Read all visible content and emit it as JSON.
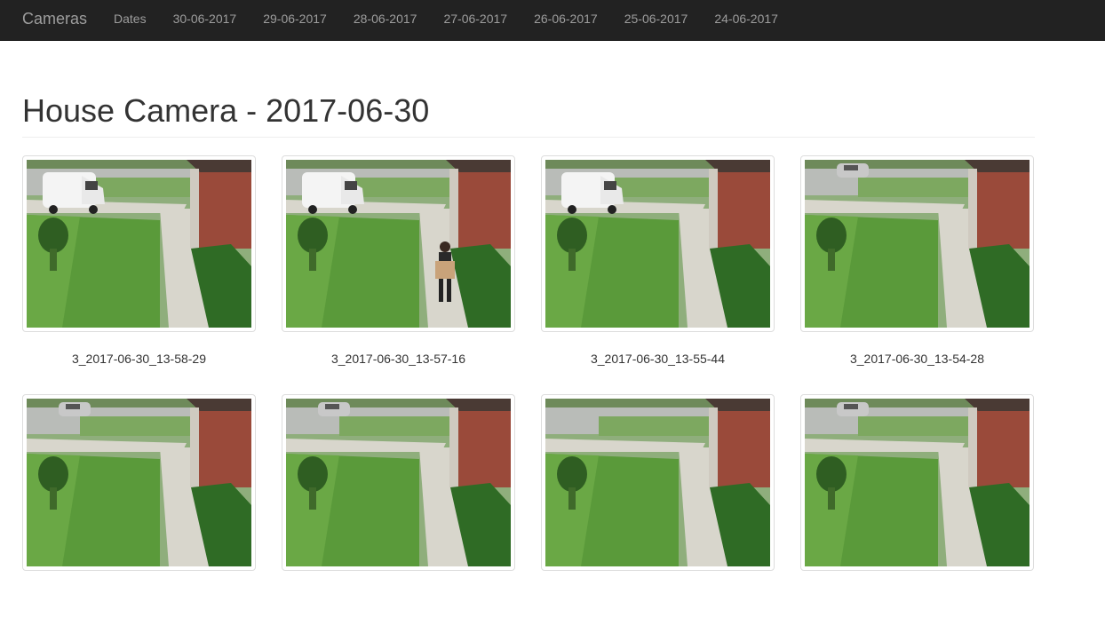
{
  "navbar": {
    "brand": "Cameras",
    "items": [
      "Dates",
      "30-06-2017",
      "29-06-2017",
      "28-06-2017",
      "27-06-2017",
      "26-06-2017",
      "25-06-2017",
      "24-06-2017"
    ]
  },
  "page": {
    "title": "House Camera - 2017-06-30"
  },
  "snapshots": [
    {
      "caption": "3_2017-06-30_13-58-29",
      "scene": "van"
    },
    {
      "caption": "3_2017-06-30_13-57-16",
      "scene": "van-person"
    },
    {
      "caption": "3_2017-06-30_13-55-44",
      "scene": "van"
    },
    {
      "caption": "3_2017-06-30_13-54-28",
      "scene": "car"
    },
    {
      "caption": "",
      "scene": "car"
    },
    {
      "caption": "",
      "scene": "car"
    },
    {
      "caption": "",
      "scene": "empty"
    },
    {
      "caption": "",
      "scene": "car"
    }
  ],
  "colors": {
    "navbar_bg": "#222222",
    "navbar_text": "#9d9d9d",
    "lawn": "#5a9a3a",
    "brick": "#9a4a3a",
    "gravel": "#d8d6cc"
  }
}
